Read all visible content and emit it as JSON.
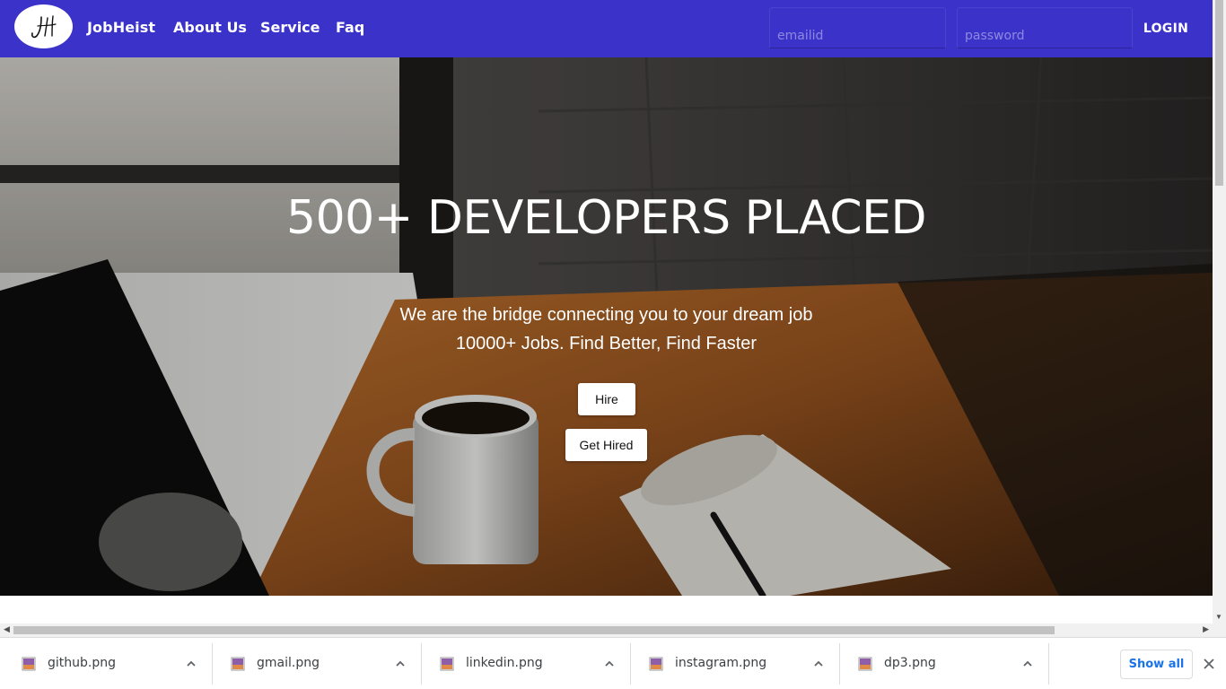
{
  "navbar": {
    "logo_text": "JH",
    "brand": "JobHeist",
    "links": {
      "about": "About Us",
      "service": "Service",
      "faq": "Faq"
    },
    "email_placeholder": "emailid",
    "password_placeholder": "password",
    "login_label": "LOGIN",
    "bg_color": "#3b32c9"
  },
  "hero": {
    "title": "500+ DEVELOPERS PLACED",
    "subtitle1": "We are the bridge connecting you to your dream job",
    "subtitle2": "10000+ Jobs. Find Better, Find Faster",
    "hire_label": "Hire",
    "get_hired_label": "Get Hired"
  },
  "downloads": {
    "items": [
      {
        "name": "github.png",
        "icon": "image-file-icon"
      },
      {
        "name": "gmail.png",
        "icon": "image-file-icon"
      },
      {
        "name": "linkedin.png",
        "icon": "image-file-icon"
      },
      {
        "name": "instagram.png",
        "icon": "image-file-icon"
      },
      {
        "name": "dp3.png",
        "icon": "image-file-icon"
      }
    ],
    "show_all_label": "Show all"
  }
}
